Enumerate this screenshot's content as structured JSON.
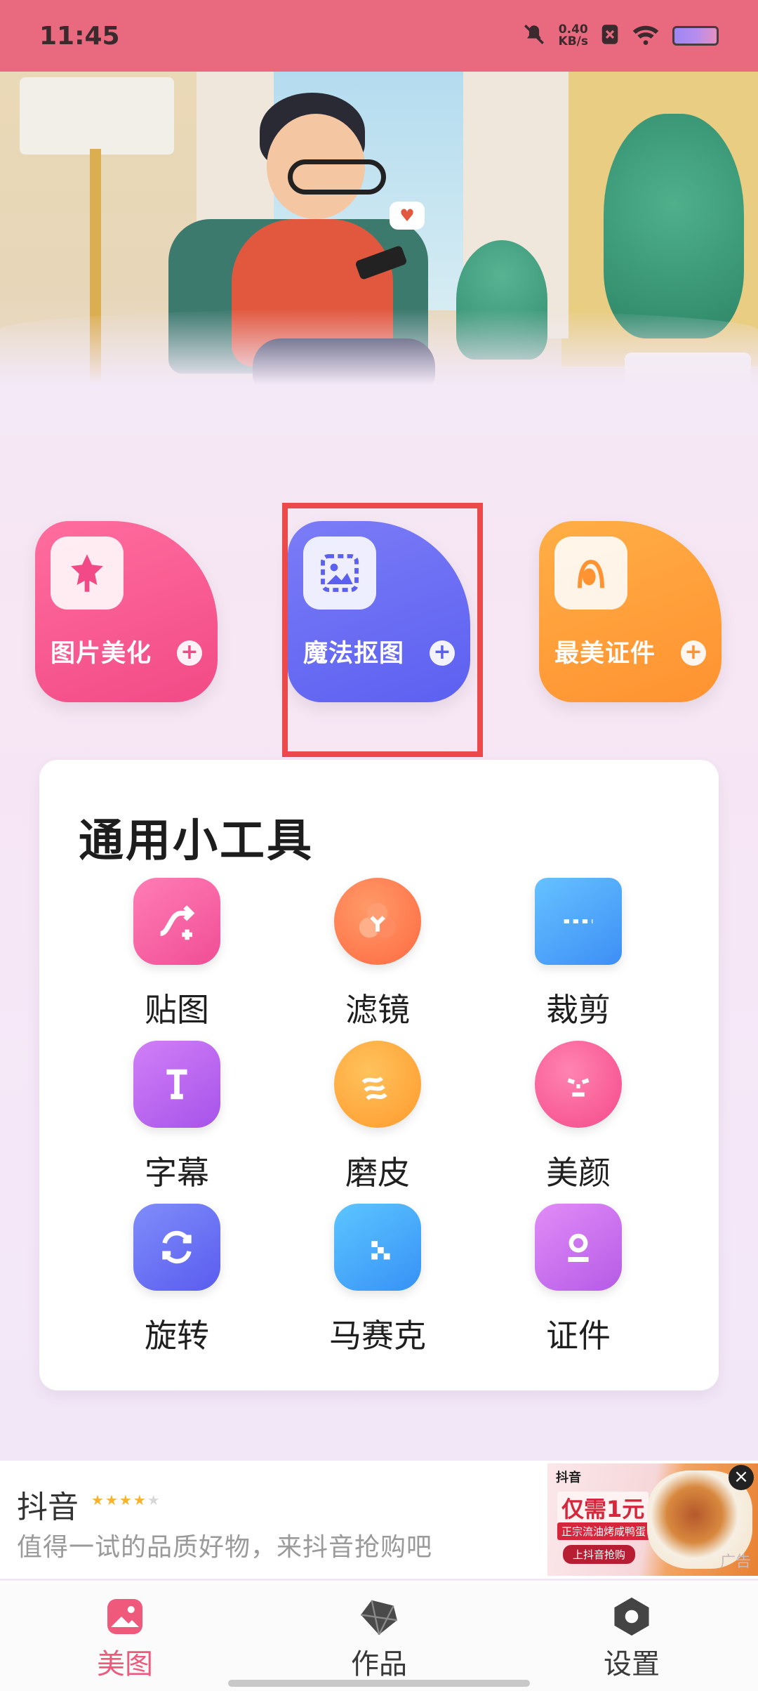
{
  "status_bar": {
    "time": "11:45",
    "speed_value": "0.40",
    "speed_unit": "KB/s",
    "icons": [
      "mute-icon",
      "speed-indicator",
      "sim-x-icon",
      "wifi-icon",
      "battery-icon"
    ]
  },
  "hero": {
    "image": "illustration-woman-on-sofa-with-phone"
  },
  "features": [
    {
      "label": "图片美化",
      "icon": "star-icon",
      "color": "#f24a86"
    },
    {
      "label": "魔法抠图",
      "icon": "image-cutout-icon",
      "color": "#5c60f0"
    },
    {
      "label": "最美证件",
      "icon": "portrait-icon",
      "color": "#ff9231"
    }
  ],
  "tools": {
    "title": "通用小工具",
    "items": [
      {
        "label": "贴图",
        "icon": "sticker-icon"
      },
      {
        "label": "滤镜",
        "icon": "filter-icon"
      },
      {
        "label": "裁剪",
        "icon": "crop-icon"
      },
      {
        "label": "字幕",
        "icon": "text-icon"
      },
      {
        "label": "磨皮",
        "icon": "smooth-skin-icon"
      },
      {
        "label": "美颜",
        "icon": "face-icon"
      },
      {
        "label": "旋转",
        "icon": "rotate-icon"
      },
      {
        "label": "马赛克",
        "icon": "mosaic-icon"
      },
      {
        "label": "证件",
        "icon": "id-photo-icon"
      }
    ]
  },
  "ad": {
    "title": "抖音",
    "rating": 4,
    "rating_max": 5,
    "description": "值得一试的品质好物，来抖音抢购吧",
    "image_brand": "抖音",
    "image_price": "仅需1元",
    "image_subtitle": "正宗流油烤咸鸭蛋",
    "image_button": "上抖音抢购",
    "tag": "广告"
  },
  "bottom_nav": {
    "items": [
      {
        "label": "美图",
        "icon": "image-icon",
        "active": true
      },
      {
        "label": "作品",
        "icon": "gem-icon",
        "active": false
      },
      {
        "label": "设置",
        "icon": "hexagon-settings-icon",
        "active": false
      }
    ]
  }
}
